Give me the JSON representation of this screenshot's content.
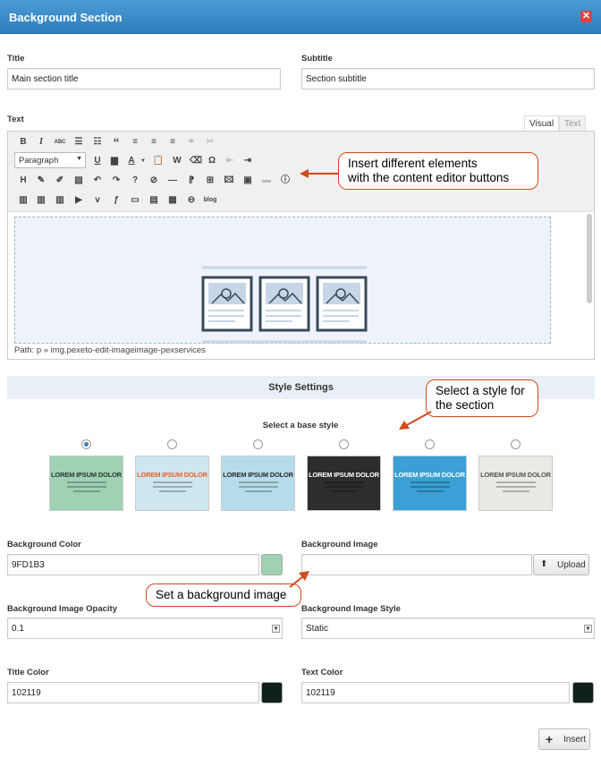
{
  "dialog": {
    "title": "Background Section",
    "close_icon": "close-icon"
  },
  "fields": {
    "title_label": "Title",
    "title_value": "Main section title",
    "subtitle_label": "Subtitle",
    "subtitle_value": "Section subtitle",
    "text_label": "Text"
  },
  "editor": {
    "tab_visual": "Visual",
    "tab_text": "Text",
    "paragraph": "Paragraph",
    "path": "Path: p » img.pexeto-edit-imageimage-pexservices",
    "blog_button": "blog",
    "toolbar_icons": [
      "bold-icon",
      "italic-icon",
      "strikethrough-icon",
      "bullet-list-icon",
      "numbered-list-icon",
      "blockquote-icon",
      "align-left-icon",
      "align-center-icon",
      "align-right-icon",
      "link-icon",
      "unlink-icon",
      "underline-icon",
      "justify-icon",
      "text-color-icon",
      "paste-text-icon",
      "paste-word-icon",
      "clear-format-icon",
      "special-char-icon",
      "outdent-icon",
      "indent-icon",
      "undo-icon",
      "redo-icon",
      "help-icon",
      "image-icon",
      "media-icon",
      "info-icon",
      "checkmark-icon",
      "star-icon",
      "arrow-icon",
      "plus-icon",
      "return-icon",
      "columns-icon",
      "video-icon",
      "vimeo-icon",
      "flash-icon",
      "button-icon",
      "box-icon"
    ]
  },
  "callouts": {
    "editor_hint_line1": "Insert different elements",
    "editor_hint_line2": "with the content editor buttons",
    "style_hint_line1": "Select a style for",
    "style_hint_line2": "the section",
    "image_hint": "Set a background image"
  },
  "style": {
    "header": "Style Settings",
    "base_label": "Select a base style",
    "selected_index": 0,
    "thumbs": [
      {
        "text": "LOREM IPSUM DOLOR",
        "bg": "#9fd1b3",
        "fg": "#2a3a30"
      },
      {
        "text": "LOREM IPSUM DOLOR",
        "bg": "#cde6ef",
        "fg": "#e8602a"
      },
      {
        "text": "LOREM IPSUM DOLOR",
        "bg": "#b5dcea",
        "fg": "#2a2a2a"
      },
      {
        "text": "LOREM IPSUM DOLOR",
        "bg": "#2d2d2d",
        "fg": "#ffffff"
      },
      {
        "text": "LOREM IPSUM DOLOR",
        "bg": "#3aa0d5",
        "fg": "#ffffff"
      },
      {
        "text": "LOREM IPSUM DOLOR",
        "bg": "#ebe9e4",
        "fg": "#555555"
      }
    ]
  },
  "settings": {
    "bg_color_label": "Background Color",
    "bg_color_value": "9FD1B3",
    "bg_color_swatch": "#9fd1b3",
    "bg_image_label": "Background Image",
    "bg_image_value": "",
    "upload_label": "Upload",
    "opacity_label": "Background Image Opacity",
    "opacity_value": "0.1",
    "image_style_label": "Background Image Style",
    "image_style_value": "Static",
    "title_color_label": "Title Color",
    "title_color_value": "102119",
    "title_color_swatch": "#102119",
    "text_color_label": "Text Color",
    "text_color_value": "102119",
    "text_color_swatch": "#102119"
  },
  "insert_label": "Insert"
}
